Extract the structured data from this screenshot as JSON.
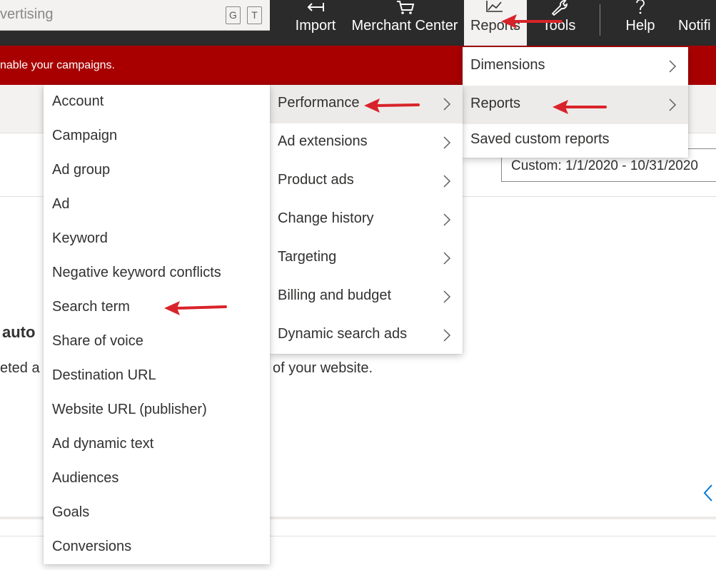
{
  "search": {
    "text": "vertising",
    "shortcuts": [
      "G",
      "T"
    ]
  },
  "nav": [
    {
      "label": "Import",
      "icon": "import-icon"
    },
    {
      "label": "Merchant Center",
      "icon": "cart-icon"
    },
    {
      "label": "Reports",
      "icon": "chart-icon",
      "active": true
    },
    {
      "label": "Tools",
      "icon": "wrench-icon"
    },
    {
      "label": "Help",
      "icon": "question-icon"
    },
    {
      "label": "Notifi",
      "icon": "bell-icon"
    }
  ],
  "banner": {
    "text": "nable your campaigns."
  },
  "page": {
    "date_range": "Custom: 1/1/2020 - 10/31/2020",
    "heading_fragment": "auto",
    "body_left_fragment": "eted a",
    "body_right_fragment": "of your website."
  },
  "reports_menu": {
    "items": [
      {
        "label": "Dimensions"
      },
      {
        "label": "Reports"
      },
      {
        "label": "Saved custom reports"
      }
    ]
  },
  "reports_submenu": {
    "items": [
      {
        "label": "Performance"
      },
      {
        "label": "Ad extensions"
      },
      {
        "label": "Product ads"
      },
      {
        "label": "Change history"
      },
      {
        "label": "Targeting"
      },
      {
        "label": "Billing and budget"
      },
      {
        "label": "Dynamic search ads"
      }
    ]
  },
  "performance_submenu": {
    "items": [
      {
        "label": "Account"
      },
      {
        "label": "Campaign"
      },
      {
        "label": "Ad group"
      },
      {
        "label": "Ad"
      },
      {
        "label": "Keyword"
      },
      {
        "label": "Negative keyword conflicts"
      },
      {
        "label": "Search term"
      },
      {
        "label": "Share of voice"
      },
      {
        "label": "Destination URL"
      },
      {
        "label": "Website URL (publisher)"
      },
      {
        "label": "Ad dynamic text"
      },
      {
        "label": "Audiences"
      },
      {
        "label": "Goals"
      },
      {
        "label": "Conversions"
      }
    ]
  },
  "colors": {
    "topbar": "#2b2b2b",
    "banner": "#a80000",
    "annotation_arrow": "#d9232a",
    "menu_highlight": "#edebe9"
  }
}
